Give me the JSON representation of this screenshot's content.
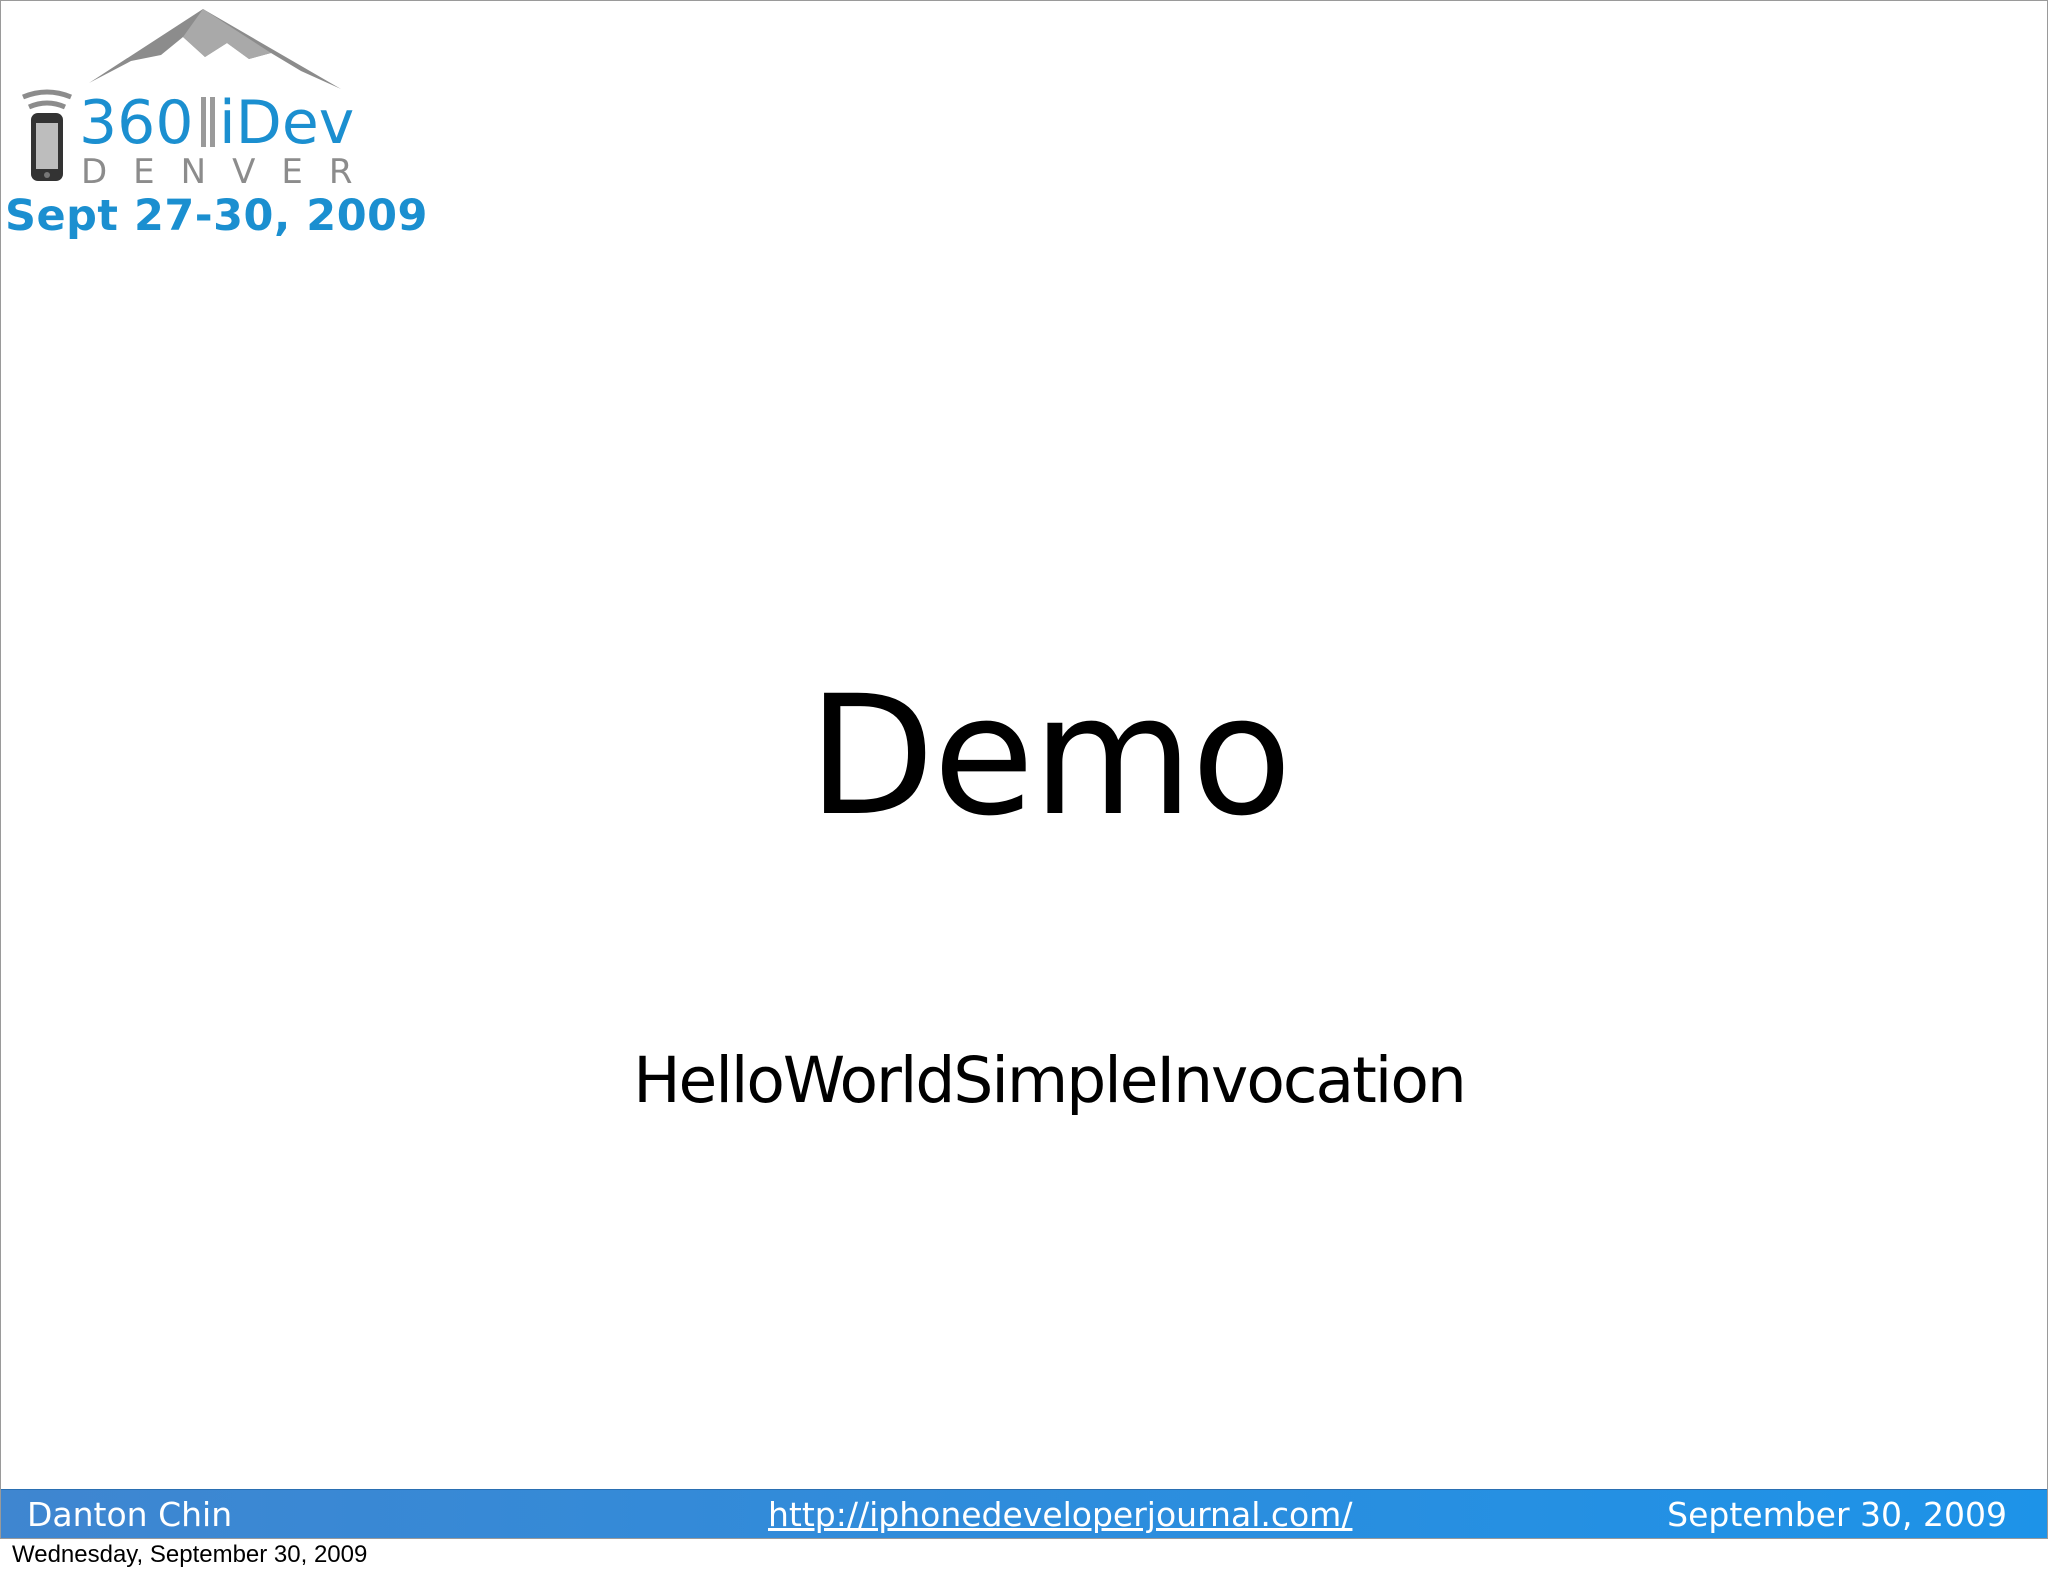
{
  "logo": {
    "number": "360",
    "brand": "iDev",
    "city": "DENVER",
    "dates": "Sept 27-30, 2009",
    "colors": {
      "blue": "#1b8fd0",
      "gray": "#8c8c8c"
    }
  },
  "slide": {
    "title": "Demo",
    "subtitle": "HelloWorldSimpleInvocation"
  },
  "footer": {
    "author": "Danton Chin",
    "url": "http://iphonedeveloperjournal.com/",
    "date": "September 30, 2009",
    "bar_color": "#2a8fdc"
  },
  "caption": "Wednesday, September 30, 2009"
}
